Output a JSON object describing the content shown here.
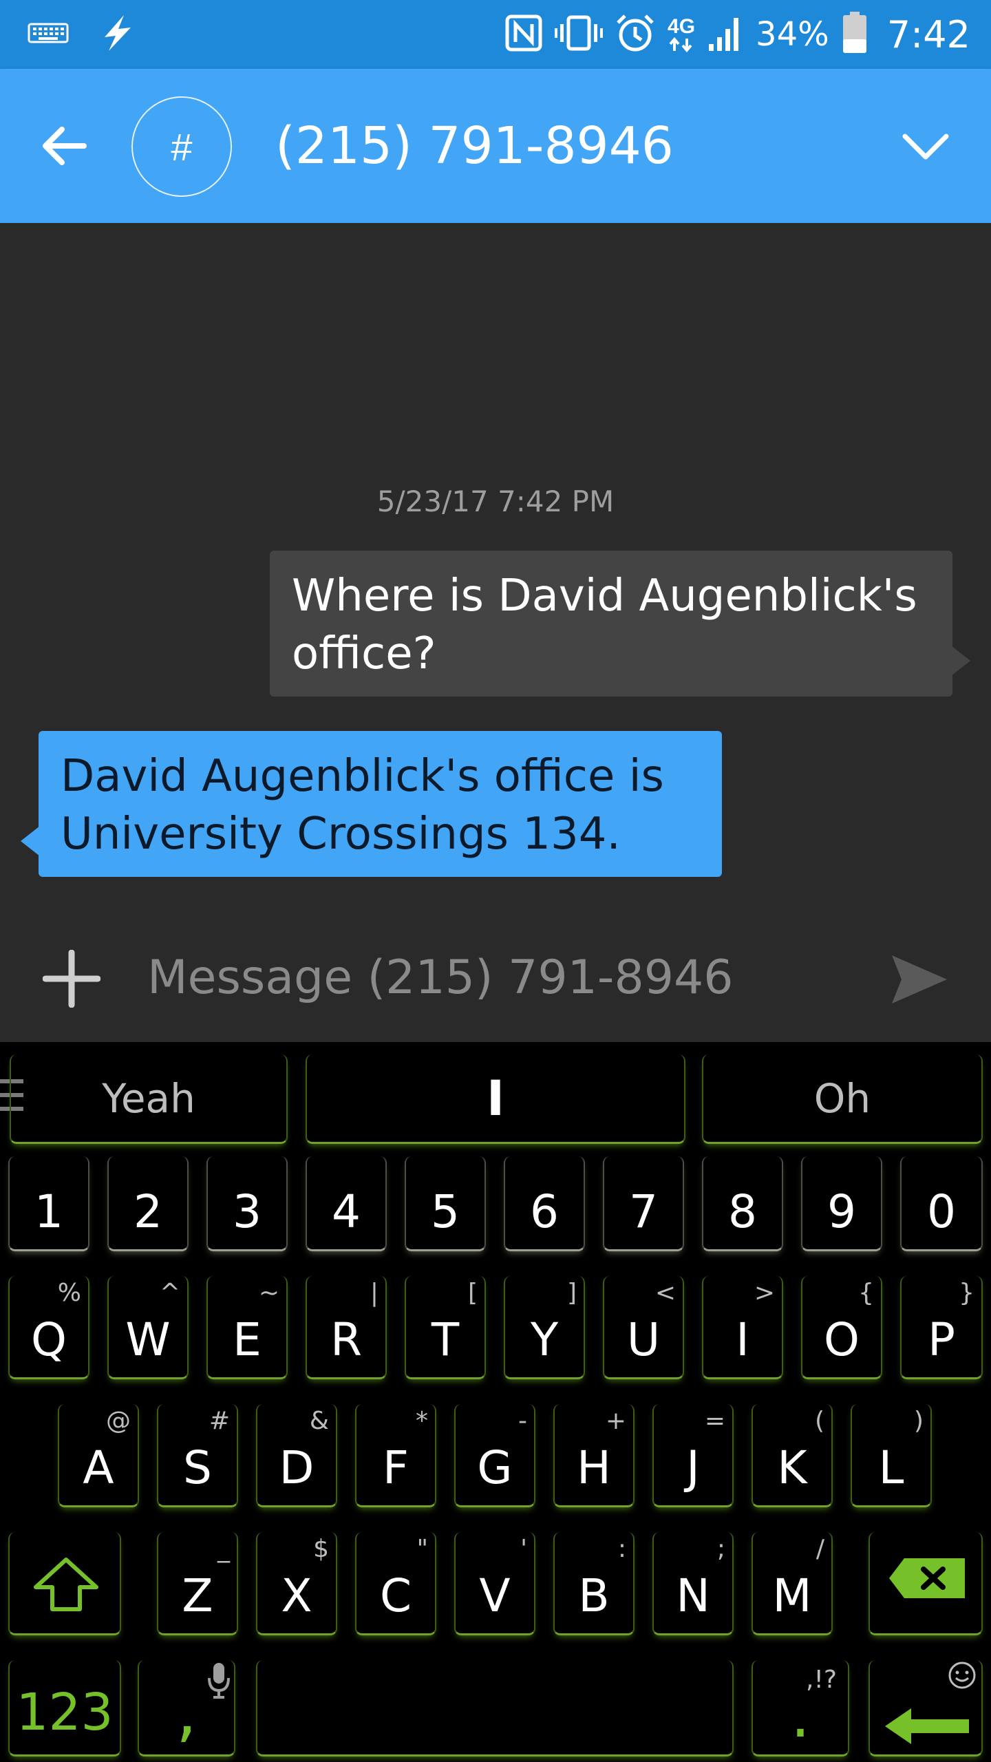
{
  "status_bar": {
    "battery_percent": "34%",
    "time": "7:42",
    "network": "4G",
    "icons": [
      "keyboard-icon",
      "flash-icon",
      "nfc-icon",
      "vibrate-icon",
      "alarm-icon",
      "4g-lte-icon",
      "signal-icon",
      "battery-icon"
    ]
  },
  "app_bar": {
    "avatar": "#",
    "title": "(215) 791-8946",
    "icons": [
      "back-arrow-icon",
      "chevron-down-icon"
    ],
    "colors": {
      "status": "#1e88d9",
      "toolbar": "#42a5f5"
    }
  },
  "conversation": {
    "timestamp": "5/23/17 7:42 PM",
    "messages": [
      {
        "direction": "outgoing",
        "text": "Where is David Augenblick's office?"
      },
      {
        "direction": "incoming",
        "text": "David Augenblick's office is University Crossings 134."
      }
    ]
  },
  "compose": {
    "placeholder": "Message (215) 791-8946",
    "icons": [
      "plus-icon",
      "send-icon"
    ]
  },
  "keyboard": {
    "suggestions": [
      "Yeah",
      "I",
      "Oh"
    ],
    "number_row": [
      "1",
      "2",
      "3",
      "4",
      "5",
      "6",
      "7",
      "8",
      "9",
      "0"
    ],
    "row1": [
      {
        "key": "Q",
        "alt": "%"
      },
      {
        "key": "W",
        "alt": "^"
      },
      {
        "key": "E",
        "alt": "~"
      },
      {
        "key": "R",
        "alt": "|"
      },
      {
        "key": "T",
        "alt": "["
      },
      {
        "key": "Y",
        "alt": "]"
      },
      {
        "key": "U",
        "alt": "<"
      },
      {
        "key": "I",
        "alt": ">"
      },
      {
        "key": "O",
        "alt": "{"
      },
      {
        "key": "P",
        "alt": "}"
      }
    ],
    "row2": [
      {
        "key": "A",
        "alt": "@"
      },
      {
        "key": "S",
        "alt": "#"
      },
      {
        "key": "D",
        "alt": "&"
      },
      {
        "key": "F",
        "alt": "*"
      },
      {
        "key": "G",
        "alt": "-"
      },
      {
        "key": "H",
        "alt": "+"
      },
      {
        "key": "J",
        "alt": "="
      },
      {
        "key": "K",
        "alt": "("
      },
      {
        "key": "L",
        "alt": ")"
      }
    ],
    "row3": [
      {
        "key": "Z",
        "alt": "_"
      },
      {
        "key": "X",
        "alt": "$"
      },
      {
        "key": "C",
        "alt": "\""
      },
      {
        "key": "V",
        "alt": "'"
      },
      {
        "key": "B",
        "alt": ":"
      },
      {
        "key": "N",
        "alt": ";"
      },
      {
        "key": "M",
        "alt": "/"
      }
    ],
    "bottom": {
      "symbols_key": "123",
      "comma_key": ",",
      "period_key": ".",
      "period_alt": ",!?"
    },
    "accent_color": "#76c12a"
  }
}
